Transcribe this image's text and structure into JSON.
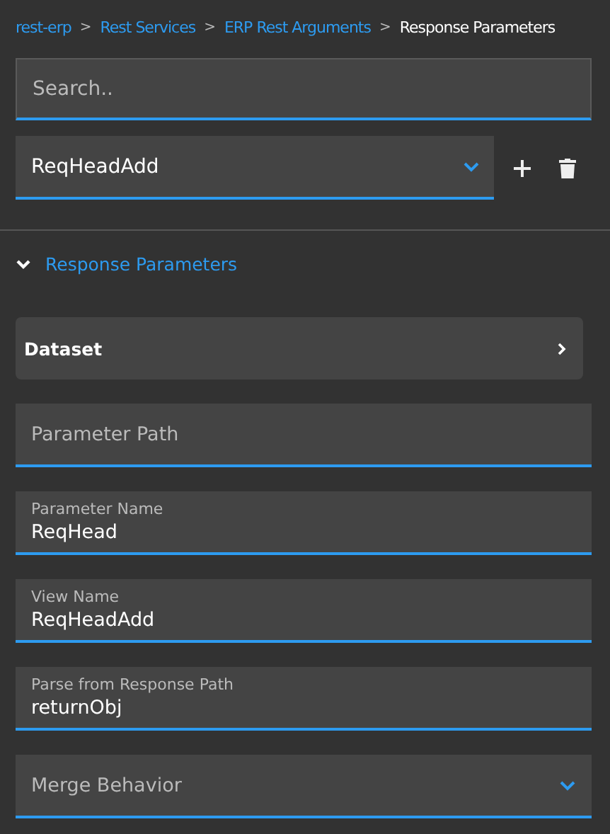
{
  "breadcrumb": [
    {
      "label": "rest-erp",
      "current": false
    },
    {
      "label": "Rest Services",
      "current": false
    },
    {
      "label": "ERP Rest Arguments",
      "current": false
    },
    {
      "label": "Response Parameters",
      "current": true
    }
  ],
  "breadcrumb_separator": ">",
  "search": {
    "placeholder": "Search.."
  },
  "view_select": {
    "value": "ReqHeadAdd"
  },
  "section": {
    "title": "Response Parameters",
    "expanded": true
  },
  "dataset": {
    "label": "Dataset"
  },
  "fields": [
    {
      "kind": "text",
      "placeholder": "Parameter Path"
    },
    {
      "kind": "text",
      "label": "Parameter Name",
      "value": "ReqHead"
    },
    {
      "kind": "text",
      "label": "View Name",
      "value": "ReqHeadAdd"
    },
    {
      "kind": "text",
      "label": "Parse from Response Path",
      "value": "returnObj"
    },
    {
      "kind": "select",
      "placeholder": "Merge Behavior"
    }
  ]
}
